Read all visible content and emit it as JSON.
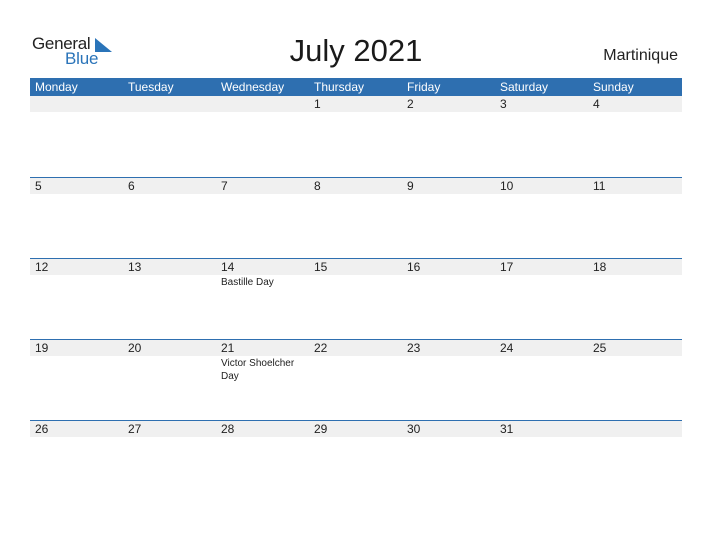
{
  "logo": {
    "general": "General",
    "blue": "Blue"
  },
  "title": "July 2021",
  "country": "Martinique",
  "colors": {
    "accent": "#2e6fb0",
    "band": "#f0f0f0"
  },
  "weekdays": [
    "Monday",
    "Tuesday",
    "Wednesday",
    "Thursday",
    "Friday",
    "Saturday",
    "Sunday"
  ],
  "weeks": [
    [
      {
        "day": ""
      },
      {
        "day": ""
      },
      {
        "day": ""
      },
      {
        "day": "1"
      },
      {
        "day": "2"
      },
      {
        "day": "3"
      },
      {
        "day": "4"
      }
    ],
    [
      {
        "day": "5"
      },
      {
        "day": "6"
      },
      {
        "day": "7"
      },
      {
        "day": "8"
      },
      {
        "day": "9"
      },
      {
        "day": "10"
      },
      {
        "day": "11"
      }
    ],
    [
      {
        "day": "12"
      },
      {
        "day": "13"
      },
      {
        "day": "14",
        "event": "Bastille Day"
      },
      {
        "day": "15"
      },
      {
        "day": "16"
      },
      {
        "day": "17"
      },
      {
        "day": "18"
      }
    ],
    [
      {
        "day": "19"
      },
      {
        "day": "20"
      },
      {
        "day": "21",
        "event": "Victor Shoelcher Day"
      },
      {
        "day": "22"
      },
      {
        "day": "23"
      },
      {
        "day": "24"
      },
      {
        "day": "25"
      }
    ],
    [
      {
        "day": "26"
      },
      {
        "day": "27"
      },
      {
        "day": "28"
      },
      {
        "day": "29"
      },
      {
        "day": "30"
      },
      {
        "day": "31"
      },
      {
        "day": ""
      }
    ]
  ]
}
